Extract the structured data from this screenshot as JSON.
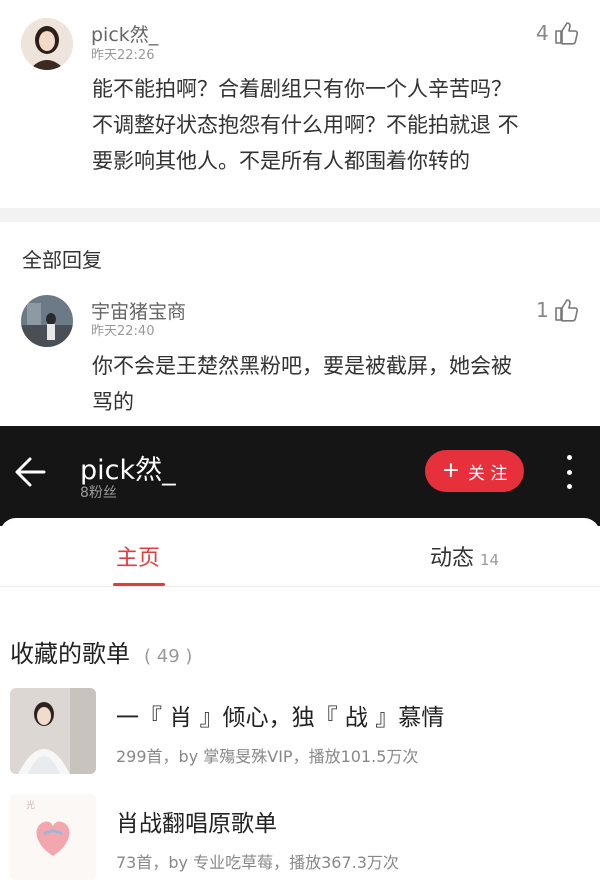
{
  "comment": {
    "user": "pick然_",
    "time": "昨天22:26",
    "likes": "4",
    "lines": [
      "能不能拍啊？合着剧组只有你一个人辛苦吗？",
      "不调整好状态抱怨有什么用啊？不能拍就退 不",
      "要影响其他人。不是所有人都围着你转的"
    ]
  },
  "replies_section": {
    "title": "全部回复",
    "reply": {
      "user": "宇宙猪宝商",
      "time": "昨天22:40",
      "likes": "1",
      "lines": [
        "你不会是王楚然黑粉吧，要是被截屏，她会被",
        "骂的"
      ]
    }
  },
  "profile": {
    "name": "pick然_",
    "fans": "8粉丝",
    "follow_label": "关 注"
  },
  "tabs": [
    {
      "label": "主页",
      "count": ""
    },
    {
      "label": "动态",
      "count": "14"
    }
  ],
  "playlists": {
    "title": "收藏的歌单",
    "count": "( 49 )",
    "items": [
      {
        "title": "一『 肖 』倾心，独『 战 』慕情",
        "meta": "299首，by 掌殤旻殊VIP，播放101.5万次"
      },
      {
        "title": "肖战翻唱原歌单",
        "meta": "73首，by 专业吃草莓，播放367.3万次"
      }
    ]
  },
  "colors": {
    "accent": "#e6313d",
    "header_bg": "#151515"
  }
}
